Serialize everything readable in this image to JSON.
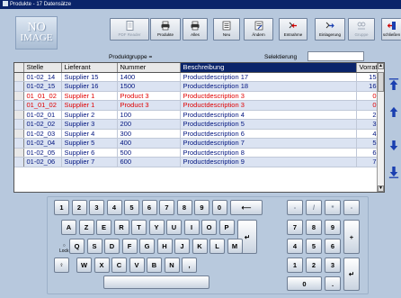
{
  "window": {
    "title": "Produkte - 17 Datensätze"
  },
  "logo": {
    "line1": "NO",
    "line2": "IMAGE"
  },
  "toolbar": {
    "buttons": [
      {
        "label": "PDF Reader",
        "icon": "document-icon",
        "enabled": false
      },
      {
        "label": "Produkte",
        "icon": "printer-icon",
        "enabled": true
      },
      {
        "label": "Alles",
        "icon": "printer-icon",
        "enabled": true
      },
      {
        "label": "Neu",
        "icon": "new-record-icon",
        "enabled": true
      },
      {
        "label": "Ändern",
        "icon": "edit-record-icon",
        "enabled": true
      },
      {
        "label": "Entnahme",
        "icon": "stock-out-icon",
        "enabled": true
      },
      {
        "label": "Einlagerung",
        "icon": "stock-in-icon",
        "enabled": true
      },
      {
        "label": "Gruppe",
        "icon": "group-icon",
        "enabled": false
      },
      {
        "label": "schließen",
        "icon": "exit-icon",
        "enabled": true
      }
    ],
    "group_label": "Produktgruppe =",
    "select_label": "Selektierung",
    "select_value": ""
  },
  "table": {
    "columns": [
      "Stelle",
      "Lieferant",
      "Nummer",
      "Beschreibung",
      "Vorrat"
    ],
    "selected_column": 3,
    "rows": [
      {
        "stelle": "01-02_14",
        "lieferant": "Supplier 15",
        "nummer": "1400",
        "beschreibung": "Productdescription 17",
        "vorrat": "15",
        "red": false
      },
      {
        "stelle": "01-02_15",
        "lieferant": "Supplier 16",
        "nummer": "1500",
        "beschreibung": "Productdescription 18",
        "vorrat": "16",
        "red": false
      },
      {
        "stelle": "01_01_02",
        "lieferant": "Supplier 1",
        "nummer": "Product 3",
        "beschreibung": "Productdescription 3",
        "vorrat": "0",
        "red": true
      },
      {
        "stelle": "01_01_02",
        "lieferant": "Supplier 1",
        "nummer": "Product 3",
        "beschreibung": "Productdescription 3",
        "vorrat": "0",
        "red": true
      },
      {
        "stelle": "01-02_01",
        "lieferant": "Supplier 2",
        "nummer": "100",
        "beschreibung": "Productdescription 4",
        "vorrat": "2",
        "red": false
      },
      {
        "stelle": "01-02_02",
        "lieferant": "Supplier 3",
        "nummer": "200",
        "beschreibung": "Productdescription 5",
        "vorrat": "3",
        "red": false
      },
      {
        "stelle": "01-02_03",
        "lieferant": "Supplier 4",
        "nummer": "300",
        "beschreibung": "Productdescription 6",
        "vorrat": "4",
        "red": false
      },
      {
        "stelle": "01-02_04",
        "lieferant": "Supplier 5",
        "nummer": "400",
        "beschreibung": "Productdescription 7",
        "vorrat": "5",
        "red": false
      },
      {
        "stelle": "01-02_05",
        "lieferant": "Supplier 6",
        "nummer": "500",
        "beschreibung": "Productdescription 8",
        "vorrat": "6",
        "red": false
      },
      {
        "stelle": "01-02_06",
        "lieferant": "Supplier 7",
        "nummer": "600",
        "beschreibung": "Productdescription 9",
        "vorrat": "7",
        "red": false
      }
    ]
  },
  "side_nav": [
    {
      "name": "first-record-icon"
    },
    {
      "name": "previous-record-icon"
    },
    {
      "name": "next-record-icon"
    },
    {
      "name": "last-record-icon"
    }
  ],
  "keyboard": {
    "row1": [
      "1",
      "2",
      "3",
      "4",
      "5",
      "6",
      "7",
      "8",
      "9",
      "0"
    ],
    "backspace": "⟵",
    "row2": [
      "A",
      "Z",
      "E",
      "R",
      "T",
      "Y",
      "U",
      "I",
      "O",
      "P"
    ],
    "enter": "↵",
    "lock_label": "Lock",
    "lock_symbol": "○",
    "row3": [
      "Q",
      "S",
      "D",
      "F",
      "G",
      "H",
      "J",
      "K",
      "L",
      "M"
    ],
    "row4": [
      "W",
      "X",
      "C",
      "V",
      "B",
      "N"
    ],
    "shift": "⇧",
    "comma": ",",
    "space": "",
    "numpad": {
      "top": [
        "-",
        "/",
        "*",
        "-"
      ],
      "rows": [
        [
          "7",
          "8",
          "9"
        ],
        [
          "4",
          "5",
          "6"
        ],
        [
          "1",
          "2",
          "3"
        ]
      ],
      "plus": "+",
      "zero": "0",
      "dot": ".",
      "enter": "↵"
    }
  }
}
